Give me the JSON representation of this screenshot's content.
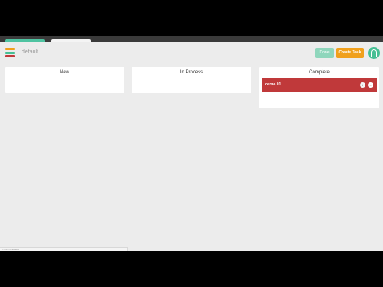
{
  "header": {
    "board_name": "default",
    "done_label": "Done",
    "create_label": "Create Task",
    "logo_colors": [
      "#f0a01c",
      "#46bf94",
      "#c0393a"
    ]
  },
  "columns": [
    {
      "title": "New",
      "tasks": []
    },
    {
      "title": "In Process",
      "tasks": []
    },
    {
      "title": "Complete",
      "tasks": [
        {
          "title": "demo 01"
        }
      ]
    }
  ],
  "status_bar": {
    "text": "localhost:3000/#"
  },
  "colors": {
    "app_background": "#ececec",
    "accent_green": "#46bf94",
    "accent_orange": "#f0a01c",
    "task_red": "#c0393a"
  }
}
